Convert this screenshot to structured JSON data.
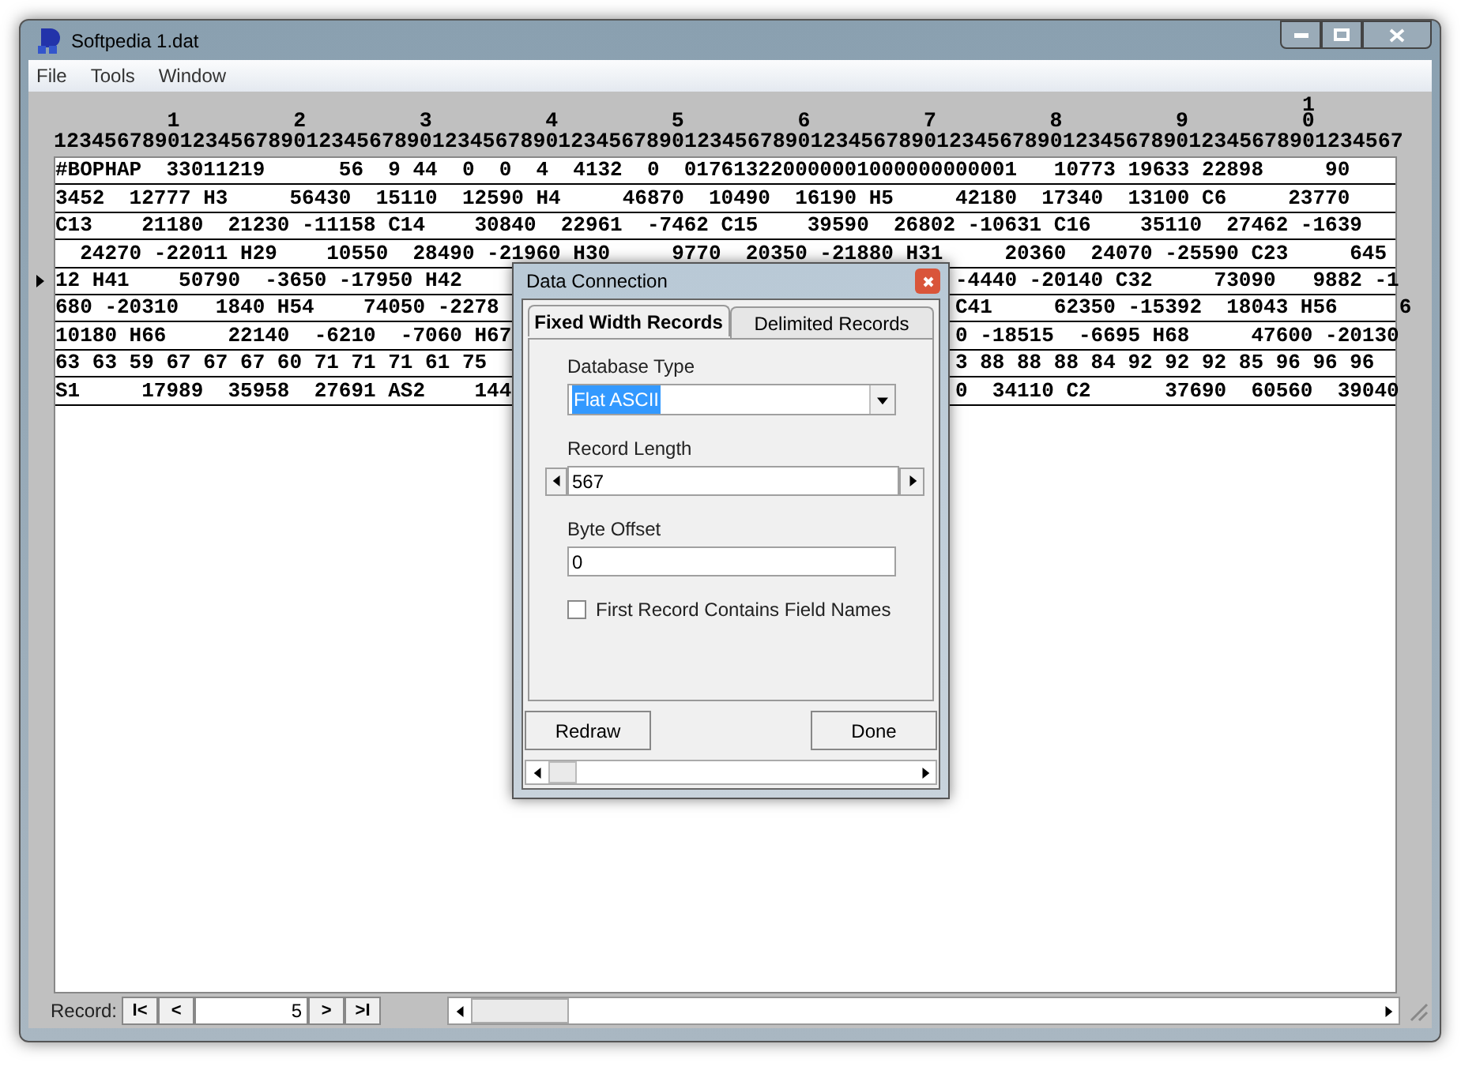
{
  "window": {
    "title": "Softpedia 1.dat"
  },
  "menu": [
    "File",
    "Tools",
    "Window"
  ],
  "ruler": {
    "hundreds": "1",
    "tens": [
      "1",
      "2",
      "3",
      "4",
      "5",
      "6",
      "7",
      "8",
      "9",
      "0"
    ],
    "units": "12345678901234567890123456789012345678901234567890123456789012345678901234567890123456789012345678901234567"
  },
  "rows": [
    {
      "current": false,
      "segments": [
        "#BOPHAP  33011219      56  9 44  0  0  4  4132  0  017613220000001000000000001   10773 19633 22898     90"
      ]
    },
    {
      "current": false,
      "segments": [
        "3452  12777 H3     56430  15110  12590 H4     46870  10490  16190 H5     42180  17340  13100 C6     23770"
      ]
    },
    {
      "current": false,
      "segments": [
        "C13    21180  21230 -11158 C14    30840  22961  -7462 C15    39590  26802 -10631 C16    35110  27462 -1639"
      ]
    },
    {
      "current": false,
      "segments": [
        "  24270 -22011 H29    10550  28490 -21960 H30     9770  20350 -21880 H31     20360  24070 -25590 C23     645"
      ]
    },
    {
      "current": true,
      "segments": [
        "12 H41    50790  -3650 -17950 H42",
        "-4440 -20140 C32     73090   9882 -1"
      ]
    },
    {
      "current": false,
      "segments": [
        "680 -20310   1840 H54    74050 -2278",
        "C41     62350 -15392  18043 H56     6"
      ]
    },
    {
      "current": false,
      "segments": [
        "10180 H66     22140  -6210  -7060 H67",
        "0 -18515  -6695 H68     47600 -20130"
      ]
    },
    {
      "current": false,
      "segments": [
        "63 63 59 67 67 67 60 71 71 71 61 75",
        "3 88 88 88 84 92 92 92 85 96 96 96"
      ]
    },
    {
      "current": false,
      "segments": [
        "S1     17989  35958  27691 AS2    144",
        "0  34110 C2      37690  60560  39040"
      ]
    }
  ],
  "dialog": {
    "title": "Data Connection",
    "tabs": [
      {
        "label": "Fixed Width Records",
        "selected": true
      },
      {
        "label": "Delimited Records",
        "selected": false
      }
    ],
    "fields": [
      {
        "kind": "select",
        "label": "Database Type",
        "value": "Flat ASCII"
      },
      {
        "kind": "spinner",
        "label": "Record Length",
        "value": "567"
      },
      {
        "kind": "text",
        "label": "Byte Offset",
        "value": "0"
      }
    ],
    "checkbox": {
      "label": "First Record Contains Field Names",
      "checked": false
    },
    "buttons": [
      "Redraw",
      "Done"
    ]
  },
  "navigator": {
    "label": "Record:",
    "before": [
      "I<",
      "<"
    ],
    "value": "5",
    "after": [
      ">",
      ">I"
    ]
  }
}
